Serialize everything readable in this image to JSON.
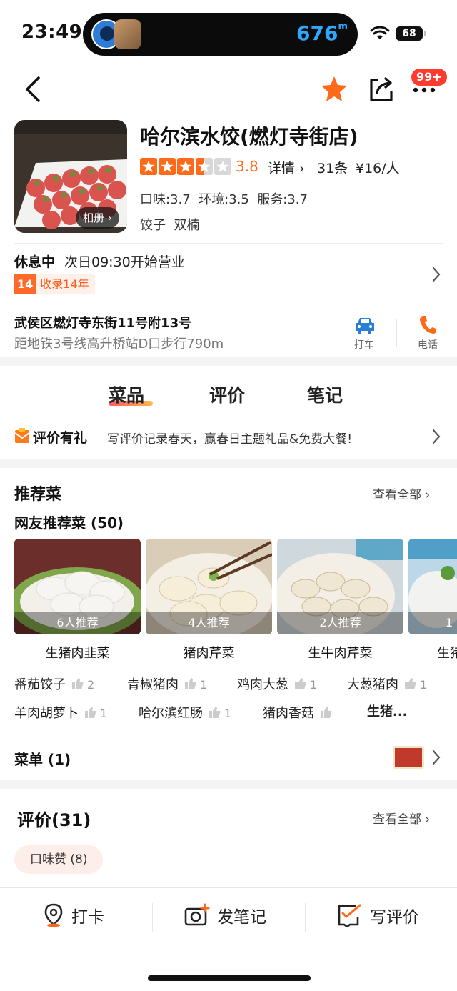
{
  "status_bar": {
    "time": "23:49",
    "distance": "676",
    "distance_unit": "m",
    "battery": "68"
  },
  "nav": {
    "badge": "99+"
  },
  "shop": {
    "name": "哈尔滨水饺(燃灯寺街店)",
    "album_label": "相册",
    "rating": 3.5,
    "score": "3.8",
    "detail_label": "详情",
    "review_count": "31条",
    "price": "¥16/人",
    "subscores": "口味:3.7  环境:3.5  服务:3.7",
    "tags": "饺子  双楠"
  },
  "status": {
    "label": "休息中",
    "text": "次日09:30开始营业",
    "years_num": "14",
    "years_text": "收录14年"
  },
  "address": {
    "line": "武侯区燃灯寺东街11号附13号",
    "sub": "距地铁3号线高升桥站D口步行790m",
    "taxi_label": "打车",
    "phone_label": "电话"
  },
  "tabs": [
    "菜品",
    "评价",
    "笔记"
  ],
  "promo": {
    "title": "评价有礼",
    "text": "写评价记录春天，赢春日主题礼品&免费大餐!"
  },
  "recommended": {
    "title": "推荐菜",
    "see_all": "查看全部",
    "subtitle": "网友推荐菜 (50)",
    "dishes": [
      {
        "name": "生猪肉韭菜",
        "rec": "6人推荐"
      },
      {
        "name": "猪肉芹菜",
        "rec": "4人推荐"
      },
      {
        "name": "生牛肉芹菜",
        "rec": "2人推荐"
      },
      {
        "name": "生猪",
        "rec": "1"
      }
    ],
    "tag_rows": [
      [
        {
          "name": "番茄饺子",
          "count": "2"
        },
        {
          "name": "青椒猪肉",
          "count": "1"
        },
        {
          "name": "鸡肉大葱",
          "count": "1"
        },
        {
          "name": "大葱猪肉",
          "count": "1"
        }
      ],
      [
        {
          "name": "羊肉胡萝卜",
          "count": "1"
        },
        {
          "name": "哈尔滨红肠",
          "count": "1"
        },
        {
          "name": "猪肉香菇",
          "count": ""
        },
        {
          "name": "生猪...",
          "count": ""
        }
      ]
    ]
  },
  "menu": {
    "title": "菜单 (1)"
  },
  "reviews": {
    "title": "评价(31)",
    "see_all": "查看全部",
    "chip": "口味赞 (8)"
  },
  "bottom_bar": {
    "checkin": "打卡",
    "note": "发笔记",
    "review": "写评价"
  },
  "colors": {
    "accent": "#ff6a1a",
    "star": "#ff6a1a",
    "blue": "#2a7fd4",
    "badge": "#ff3b2f"
  }
}
